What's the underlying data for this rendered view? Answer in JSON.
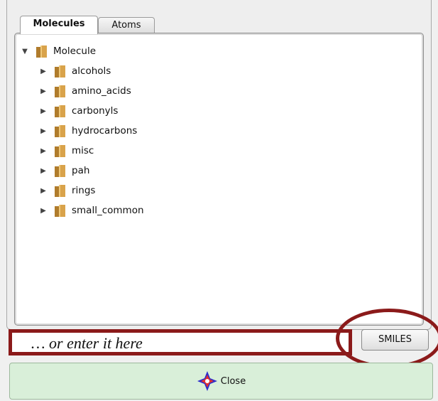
{
  "tabs": [
    {
      "label": "Molecules",
      "active": true
    },
    {
      "label": "Atoms",
      "active": false
    }
  ],
  "tree": {
    "root": {
      "label": "Molecule",
      "expanded": true,
      "icon": "folder-icon"
    },
    "children": [
      {
        "label": "alcohols",
        "icon": "folder-icon"
      },
      {
        "label": "amino_acids",
        "icon": "folder-icon"
      },
      {
        "label": "carbonyls",
        "icon": "folder-icon"
      },
      {
        "label": "hydrocarbons",
        "icon": "folder-icon"
      },
      {
        "label": "misc",
        "icon": "folder-icon"
      },
      {
        "label": "pah",
        "icon": "folder-icon"
      },
      {
        "label": "rings",
        "icon": "folder-icon"
      },
      {
        "label": "small_common",
        "icon": "folder-icon"
      }
    ]
  },
  "smiles": {
    "placeholder": "… or enter it here",
    "button_label": "SMILES"
  },
  "close": {
    "label": "Close",
    "icon": "molecule-icon"
  },
  "colors": {
    "annotation": "#8b1a1a",
    "close_bg": "#d9efd9",
    "folder": "#c8963e"
  }
}
